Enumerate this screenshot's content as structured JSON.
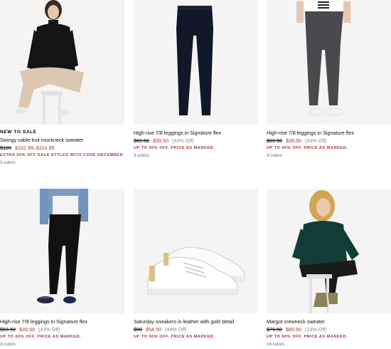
{
  "products": [
    {
      "badge": "NEW TO SALE",
      "title": "Swingy cable-knit mockneck sweater",
      "was_price": "$128",
      "sale_price": "$101.99–$114.99",
      "discount": "",
      "promo": "EXTRA 50% OFF SALE STYLES WITH CODE DECEMBER",
      "colors": "3 colors",
      "image_alt": "model in black sweater"
    },
    {
      "badge": "",
      "title": "High-rise 7/8 leggings in Signature flex",
      "was_price": "$69.50",
      "sale_price": "$39.50",
      "discount": "(43% Off)",
      "promo": "UP TO 60% OFF. PRICE AS MARKED.",
      "colors": "3 colors",
      "image_alt": "navy leggings"
    },
    {
      "badge": "",
      "title": "High-rise 7/8 leggings in Signature flex",
      "was_price": "$69.50",
      "sale_price": "$39.50",
      "discount": "(43% Off)",
      "promo": "UP TO 60% OFF. PRICE AS MARKED.",
      "colors": "3 colors",
      "image_alt": "model in grey leggings"
    },
    {
      "badge": "",
      "title": "High-rise 7/8 leggings in Signature flex",
      "was_price": "$69.50",
      "sale_price": "$39.50",
      "discount": "(43% Off)",
      "promo": "UP TO 60% OFF. PRICE AS MARKED.",
      "colors": "3 colors",
      "image_alt": "model in black leggings"
    },
    {
      "badge": "",
      "title": "Saturday sneakers in leather with gold detail",
      "was_price": "$98",
      "sale_price": "$54.50",
      "discount": "(44% Off)",
      "promo": "UP TO 60% OFF. PRICE AS MARKED.",
      "colors": "",
      "image_alt": "white leather sneakers"
    },
    {
      "badge": "",
      "title": "Margot crewneck sweater",
      "was_price": "$79.50",
      "sale_price": "$60.50",
      "discount": "(23% Off)",
      "promo": "UP TO 60% OFF. PRICE AS MARKED.",
      "colors": "16 colors",
      "image_alt": "model in green sweater"
    }
  ],
  "colors": {
    "sale_red": "#b2363a",
    "muted_grey": "#888888",
    "image_bg": "#f4f4f4"
  }
}
